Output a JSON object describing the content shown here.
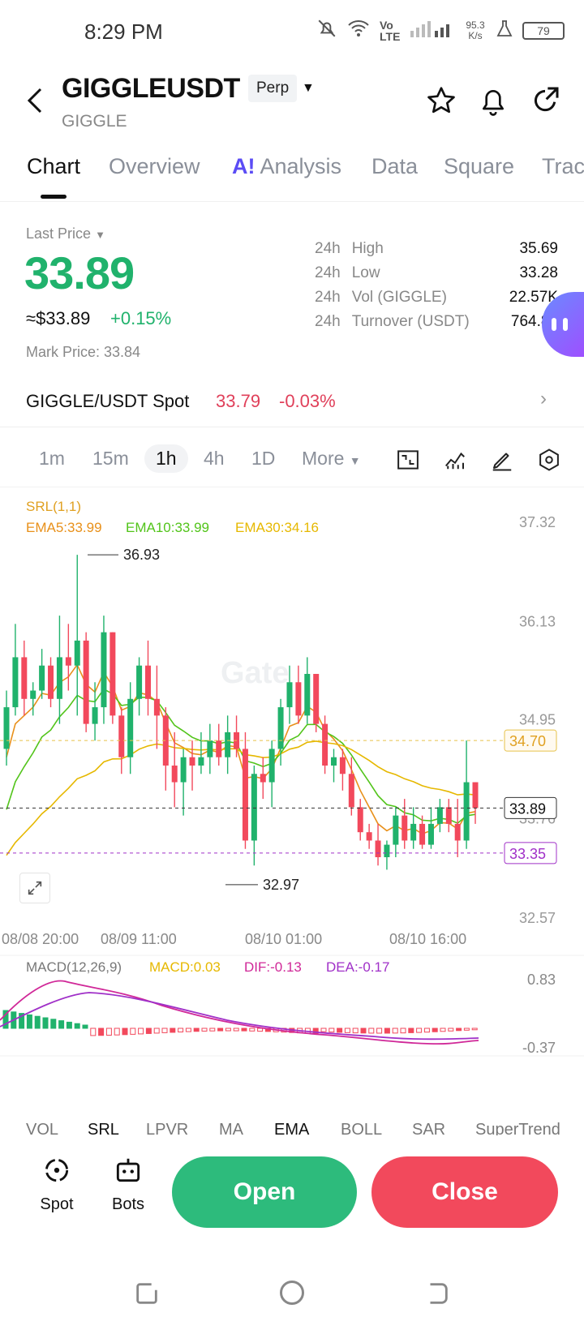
{
  "status": {
    "time": "8:29 PM",
    "network": "Vo LTE",
    "speed": "95.3 K/s",
    "battery": "79"
  },
  "header": {
    "symbol": "GIGGLEUSDT",
    "badge": "Perp",
    "subtitle": "GIGGLE"
  },
  "tabs": [
    "Chart",
    "Overview",
    "Analysis",
    "Data",
    "Square",
    "Trac"
  ],
  "ai_mark": "A!",
  "price": {
    "label": "Last Price",
    "value": "33.89",
    "usd": "≈$33.89",
    "change": "+0.15%",
    "mark": "Mark Price: 33.84"
  },
  "stats": [
    {
      "p": "24h",
      "k": "High",
      "v": "35.69"
    },
    {
      "p": "24h",
      "k": "Low",
      "v": "33.28"
    },
    {
      "p": "24h",
      "k": "Vol (GIGGLE)",
      "v": "22.57K"
    },
    {
      "p": "24h",
      "k": "Turnover (USDT)",
      "v": "764.80"
    }
  ],
  "spot": {
    "name": "GIGGLE/USDT Spot",
    "price": "33.79",
    "change": "-0.03%"
  },
  "timeframes": [
    "1m",
    "15m",
    "1h",
    "4h",
    "1D",
    "More"
  ],
  "chart_data": {
    "type": "candlestick",
    "indicator": "SRL(1,1)",
    "ema": [
      {
        "name": "EMA5:33.99",
        "color": "#e8901a"
      },
      {
        "name": "EMA10:33.99",
        "color": "#52c41a"
      },
      {
        "name": "EMA30:34.16",
        "color": "#e6b800"
      }
    ],
    "y_ticks": [
      "37.32",
      "36.13",
      "34.95",
      "33.76",
      "32.57"
    ],
    "ylim": [
      32.57,
      37.32
    ],
    "x_ticks": [
      "08/08 20:00",
      "08/09 11:00",
      "08/10 01:00",
      "08/10 16:00"
    ],
    "max_label": "36.93",
    "min_label": "32.97",
    "level_high": "34.70",
    "level_current": "33.89",
    "level_low": "33.35",
    "watermark": "Gate",
    "candles": [
      [
        34.6,
        35.3,
        34.4,
        35.1
      ],
      [
        35.1,
        36.1,
        35.0,
        35.7
      ],
      [
        35.7,
        35.9,
        35.0,
        35.2
      ],
      [
        35.2,
        35.4,
        35.0,
        35.3
      ],
      [
        35.3,
        35.8,
        35.2,
        35.6
      ],
      [
        35.6,
        35.7,
        35.1,
        35.2
      ],
      [
        35.2,
        36.2,
        34.9,
        35.7
      ],
      [
        35.7,
        36.1,
        35.3,
        35.6
      ],
      [
        35.6,
        36.93,
        35.0,
        35.9
      ],
      [
        35.9,
        36.0,
        34.8,
        34.9
      ],
      [
        34.9,
        35.4,
        34.7,
        35.1
      ],
      [
        35.1,
        36.2,
        34.9,
        36.0
      ],
      [
        36.0,
        36.0,
        34.9,
        35.0
      ],
      [
        35.0,
        35.1,
        34.3,
        34.5
      ],
      [
        34.5,
        35.4,
        34.3,
        35.2
      ],
      [
        35.2,
        35.7,
        35.0,
        35.6
      ],
      [
        35.6,
        35.9,
        35.0,
        35.2
      ],
      [
        35.2,
        35.6,
        34.6,
        35.0
      ],
      [
        35.0,
        35.1,
        34.1,
        34.4
      ],
      [
        34.4,
        34.8,
        33.9,
        34.2
      ],
      [
        34.2,
        34.6,
        33.8,
        34.5
      ],
      [
        34.5,
        34.7,
        34.1,
        34.4
      ],
      [
        34.4,
        34.8,
        34.3,
        34.5
      ],
      [
        34.5,
        34.9,
        34.3,
        34.7
      ],
      [
        34.7,
        34.9,
        34.4,
        34.5
      ],
      [
        34.5,
        35.0,
        34.3,
        34.8
      ],
      [
        34.8,
        35.0,
        34.5,
        34.6
      ],
      [
        34.6,
        34.8,
        33.4,
        33.5
      ],
      [
        33.5,
        34.4,
        33.2,
        34.3
      ],
      [
        34.3,
        34.5,
        34.0,
        34.2
      ],
      [
        34.2,
        34.7,
        33.9,
        34.6
      ],
      [
        34.6,
        35.2,
        34.4,
        35.1
      ],
      [
        35.1,
        35.6,
        34.9,
        35.4
      ],
      [
        35.4,
        35.6,
        34.9,
        35.0
      ],
      [
        35.0,
        35.7,
        34.9,
        35.5
      ],
      [
        35.5,
        35.5,
        34.8,
        34.9
      ],
      [
        34.9,
        35.0,
        34.3,
        34.4
      ],
      [
        34.4,
        34.6,
        34.2,
        34.5
      ],
      [
        34.5,
        34.6,
        34.1,
        34.3
      ],
      [
        34.3,
        34.5,
        33.8,
        33.9
      ],
      [
        33.9,
        34.0,
        33.5,
        33.6
      ],
      [
        33.6,
        33.7,
        33.4,
        33.5
      ],
      [
        33.5,
        33.7,
        33.2,
        33.3
      ],
      [
        33.3,
        33.5,
        33.15,
        33.45
      ],
      [
        33.45,
        33.9,
        33.3,
        33.8
      ],
      [
        33.8,
        34.0,
        33.4,
        33.5
      ],
      [
        33.5,
        33.9,
        33.4,
        33.7
      ],
      [
        33.7,
        33.8,
        33.4,
        33.45
      ],
      [
        33.45,
        33.9,
        33.4,
        33.7
      ],
      [
        33.7,
        34.0,
        33.6,
        33.9
      ],
      [
        33.9,
        34.0,
        33.6,
        33.7
      ],
      [
        33.7,
        34.0,
        33.3,
        33.5
      ],
      [
        33.5,
        34.7,
        33.4,
        34.2
      ],
      [
        34.2,
        34.2,
        33.7,
        33.89
      ]
    ],
    "macd": {
      "label": "MACD(12,26,9)",
      "macd": "MACD:0.03",
      "dif": "DIF:-0.13",
      "dea": "DEA:-0.17",
      "y_ticks": [
        "0.83",
        "-0.37"
      ]
    }
  },
  "indicator_tabs": [
    "VOL",
    "SRL",
    "LPVR",
    "MA",
    "EMA",
    "BOLL",
    "SAR",
    "SuperTrend"
  ],
  "bottom": {
    "spot": "Spot",
    "bots": "Bots",
    "open": "Open",
    "close": "Close"
  },
  "colors": {
    "up": "#20b26c",
    "down": "#f2495c",
    "accent": "#5b4cf5"
  }
}
